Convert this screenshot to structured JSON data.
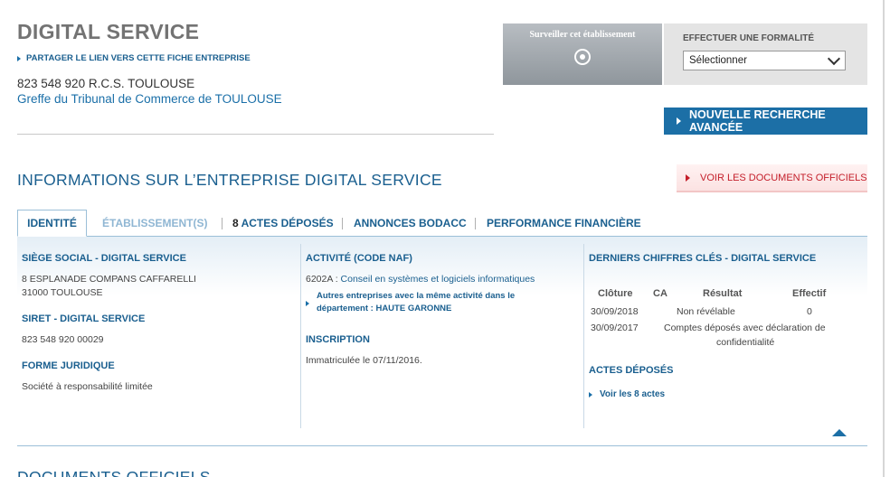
{
  "header": {
    "company_name": "DIGITAL SERVICE",
    "share_link": "PARTAGER LE LIEN VERS CETTE FICHE ENTREPRISE",
    "rcs": "823 548 920  R.C.S. TOULOUSE",
    "greffe": "Greffe du Tribunal de Commerce de TOULOUSE"
  },
  "watch": {
    "label": "Surveiller cet établissement",
    "icon": "target-icon"
  },
  "formality": {
    "label": "EFFECTUER UNE FORMALITÉ",
    "select_value": "Sélectionner"
  },
  "new_search": {
    "label": "NOUVELLE RECHERCHE AVANCÉE"
  },
  "section": {
    "title": "INFORMATIONS SUR L’ENTREPRISE DIGITAL SERVICE",
    "docs_button": "VOIR LES DOCUMENTS OFFICIELS"
  },
  "tabs": [
    {
      "label": "IDENTITÉ",
      "active": true
    },
    {
      "label": "ÉTABLISSEMENT(S)"
    },
    {
      "count": "8",
      "label": " ACTES DÉPOSÉS"
    },
    {
      "label": "ANNONCES BODACC"
    },
    {
      "label": "PERFORMANCE FINANCIÈRE"
    }
  ],
  "identity": {
    "siege_title": "SIÈGE SOCIAL - DIGITAL SERVICE",
    "address_1": "8 ESPLANADE COMPANS CAFFARELLI",
    "address_2": "31000 TOULOUSE",
    "siret_title": "SIRET - DIGITAL SERVICE",
    "siret": "823 548 920 00029",
    "forme_title": "FORME JURIDIQUE",
    "forme": "Société à responsabilité limitée"
  },
  "activity": {
    "title": "ACTIVITÉ (CODE NAF)",
    "code": "6202A : ",
    "code_label": "Conseil en systèmes et logiciels informatiques",
    "other_line1": "Autres entreprises avec la même activité dans le",
    "other_line2": "département : HAUTE GARONNE",
    "inscription_title": "INSCRIPTION",
    "inscription": "Immatriculée le 07/11/2016."
  },
  "key_figures": {
    "title": "DERNIERS CHIFFRES CLÉS - DIGITAL SERVICE",
    "columns": [
      "Clôture",
      "CA",
      "Résultat",
      "Effectif"
    ],
    "rows": [
      {
        "cloture": "30/09/2018",
        "note": "Non révélable",
        "effectif": "0"
      },
      {
        "cloture": "30/09/2017",
        "note_line1": "Comptes déposés avec déclaration de",
        "note_line2": "confidentialité"
      }
    ],
    "actes_title": "ACTES DÉPOSÉS",
    "actes_link": "Voir les 8 actes"
  },
  "next_section": {
    "title": "DOCUMENTS OFFICIELS"
  }
}
